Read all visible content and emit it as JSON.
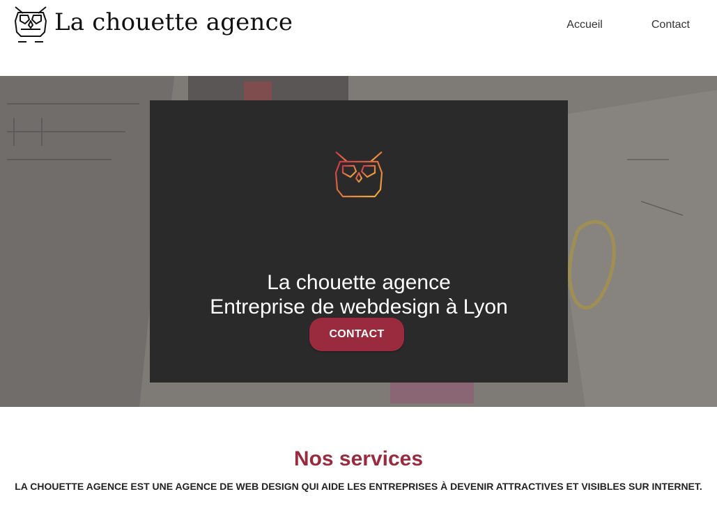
{
  "header": {
    "brand": "La chouette agence",
    "nav": [
      {
        "label": "Accueil"
      },
      {
        "label": "Contact"
      }
    ]
  },
  "hero": {
    "title_line1": "La chouette agence",
    "title_line2": "Entreprise de webdesign à Lyon",
    "cta_label": "CONTACT"
  },
  "services": {
    "title": "Nos services",
    "description": "LA CHOUETTE AGENCE EST UNE AGENCE DE WEB DESIGN QUI AIDE LES ENTREPRISES À DEVENIR ATTRACTIVES ET VISIBLES SUR INTERNET."
  },
  "colors": {
    "accent": "#9a2b3f",
    "card": "#2b2a2a",
    "logo_gradient_start": "#c8354a",
    "logo_gradient_end": "#f2b33a"
  },
  "icons": {
    "brand_logo": "owl-icon",
    "card_logo": "owl-icon"
  }
}
